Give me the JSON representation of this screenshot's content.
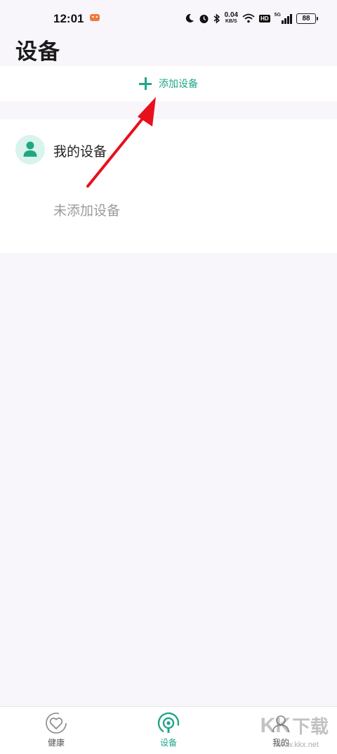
{
  "status_bar": {
    "time": "12:01",
    "net_speed_value": "0.04",
    "net_speed_unit": "KB/S",
    "hd_label": "HD",
    "signal_label": "5G",
    "battery": "88",
    "icons": [
      "game-icon",
      "moon-icon",
      "alarm-icon",
      "bluetooth-icon",
      "wifi-icon",
      "hd-icon",
      "signal-icon",
      "battery-icon"
    ]
  },
  "header": {
    "title": "设备"
  },
  "add_device": {
    "label": "添加设备"
  },
  "my_devices": {
    "title": "我的设备",
    "empty_text": "未添加设备"
  },
  "tabs": [
    {
      "label": "健康",
      "icon": "health-heart-icon",
      "active": false
    },
    {
      "label": "设备",
      "icon": "device-watch-icon",
      "active": true
    },
    {
      "label": "我的",
      "icon": "profile-icon",
      "active": false
    }
  ],
  "watermark": {
    "text_a": "KK",
    "text_b": "下载",
    "url": "www.kkx.net"
  },
  "colors": {
    "accent": "#22a58a",
    "arrow": "#e8101c",
    "background": "#f8f6fa"
  }
}
